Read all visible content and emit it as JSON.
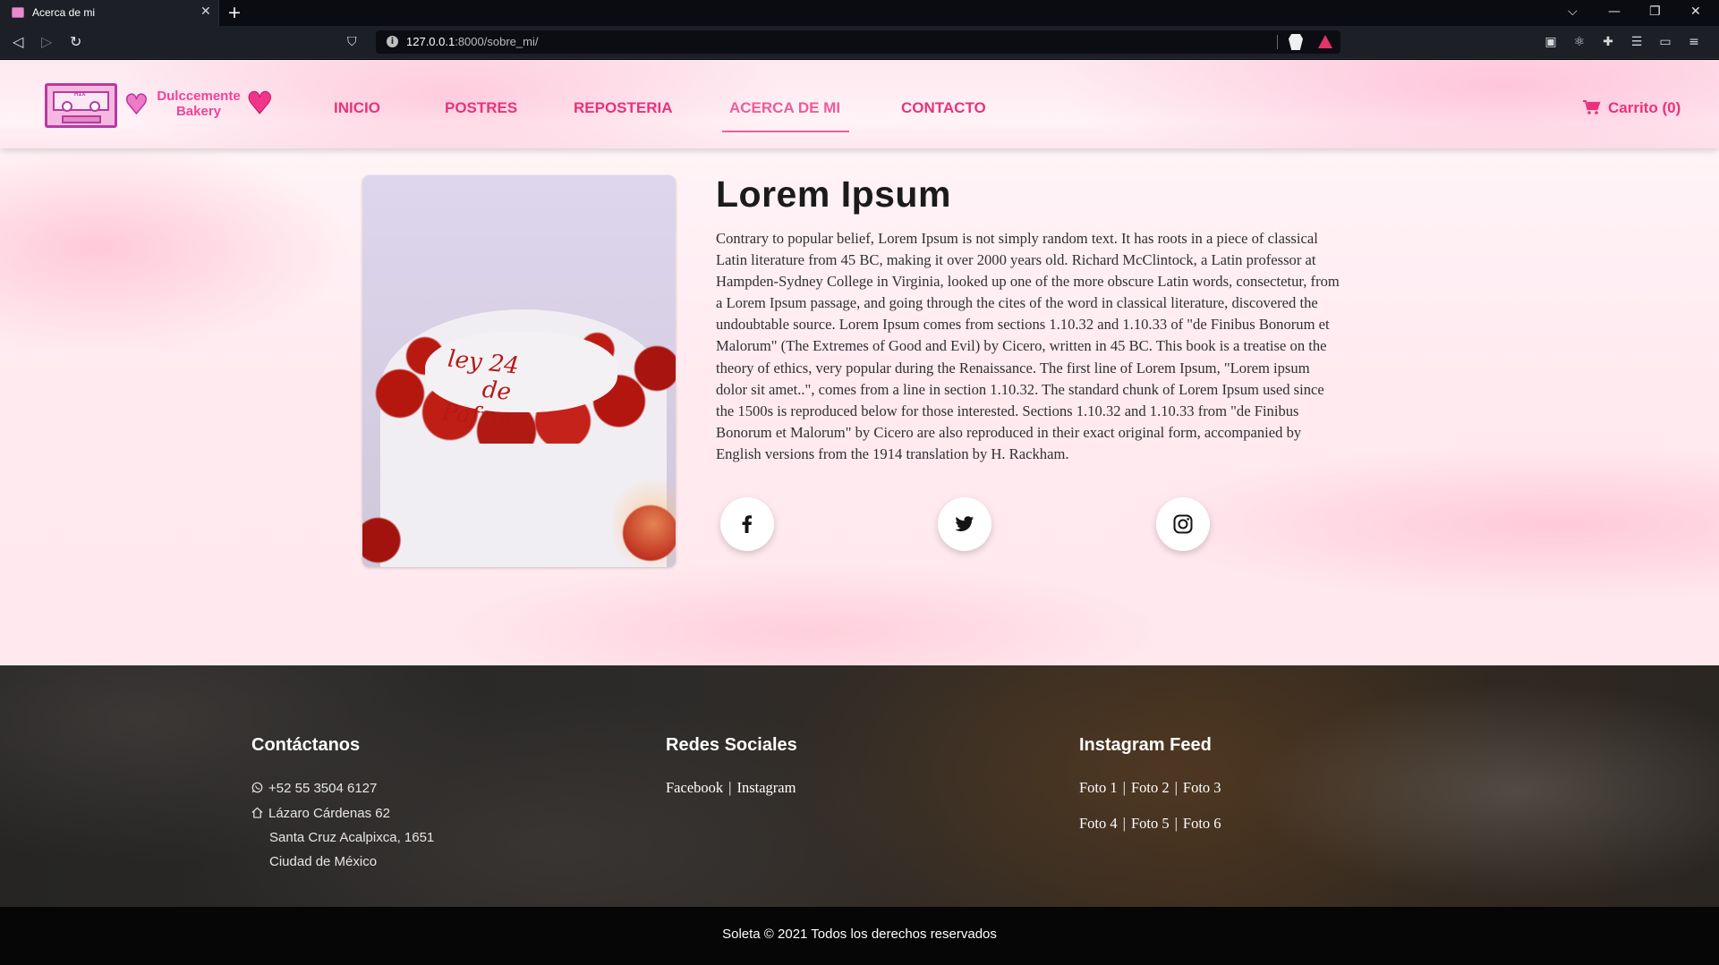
{
  "browser": {
    "tab_title": "Acerca de mi",
    "tab_close": "✕",
    "new_tab": "+",
    "url_host": "127.0.0.1",
    "url_path": ":8000/sobre_mi/",
    "controls": {
      "dropdown": "⌵",
      "minimize": "—",
      "restore": "❐",
      "close": "✕"
    }
  },
  "header": {
    "logo_cassette_text": "MIX",
    "logo_text_line1": "Dulccemente",
    "logo_text_line2": "Bakery",
    "nav": [
      {
        "label": "INICIO"
      },
      {
        "label": "POSTRES"
      },
      {
        "label": "REPOSTERIA"
      },
      {
        "label": "ACERCA DE MI",
        "active": true
      },
      {
        "label": "CONTACTO"
      }
    ],
    "cart_label": "Carrito (0)"
  },
  "about": {
    "title": "Lorem Ipsum",
    "text": "Contrary to popular belief, Lorem Ipsum is not simply random text. It has roots in a piece of classical Latin literature from 45 BC, making it over 2000 years old. Richard McClintock, a Latin professor at Hampden-Sydney College in Virginia, looked up one of the more obscure Latin words, consectetur, from a Lorem Ipsum passage, and going through the cites of the word in classical literature, discovered the undoubtable source. Lorem Ipsum comes from sections 1.10.32 and 1.10.33 of \"de Finibus Bonorum et Malorum\" (The Extremes of Good and Evil) by Cicero, written in 45 BC. This book is a treatise on the theory of ethics, very popular during the Renaissance. The first line of Lorem Ipsum, \"Lorem ipsum dolor sit amet..\", comes from a line in section 1.10.32. The standard chunk of Lorem Ipsum used since the 1500s is reproduced below for those interested. Sections 1.10.32 and 1.10.33 from \"de Finibus Bonorum et Malorum\" by Cicero are also reproduced in their exact original form, accompanied by English versions from the 1914 translation by H. Rackham.",
    "cake_writing_line1": "ley 24",
    "cake_writing_line2": "de",
    "cake_writing_line3": "Pafuna",
    "social_icons": [
      "facebook-icon",
      "twitter-icon",
      "instagram-icon"
    ]
  },
  "footer": {
    "contact": {
      "heading": "Contáctanos",
      "phone": "+52 55 3504 6127",
      "address_line1": "Lázaro Cárdenas 62",
      "address_line2": "Santa Cruz Acalpixca, 1651",
      "address_line3": "Ciudad de México"
    },
    "social": {
      "heading": "Redes Sociales",
      "facebook": "Facebook",
      "separator": "|",
      "instagram": "Instagram"
    },
    "instagram_feed": {
      "heading": "Instagram Feed",
      "photos": [
        "Foto 1",
        "Foto 2",
        "Foto 3",
        "Foto 4",
        "Foto 5",
        "Foto 6"
      ]
    }
  },
  "copyright": "Soleta © 2021 Todos los derechos reservados",
  "colors": {
    "accent_pink": "#e8337c",
    "active_nav": "#f05b9a",
    "footer_bg": "#2b2927",
    "copyright_bg": "#060606"
  }
}
